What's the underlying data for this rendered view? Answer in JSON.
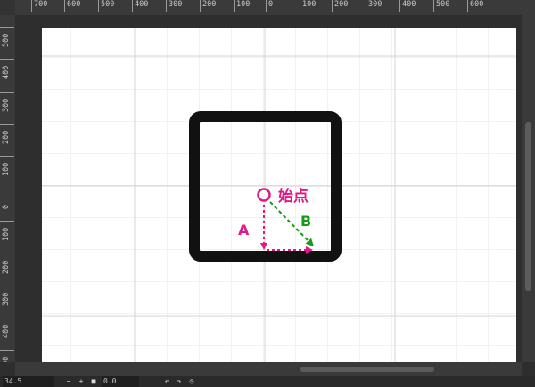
{
  "ruler_top": [
    "700",
    "600",
    "500",
    "400",
    "300",
    "200",
    "100",
    "0",
    "100",
    "200",
    "300",
    "400",
    "500",
    "600"
  ],
  "ruler_left": [
    "500",
    "400",
    "300",
    "200",
    "100",
    "0",
    "100",
    "200",
    "300",
    "400",
    "500"
  ],
  "annotation": {
    "start_label": "始点",
    "label_a": "A",
    "label_b": "B"
  },
  "statusbar": {
    "zoom": "34.5",
    "zoom_out": "−",
    "zoom_in": "+",
    "reset": "■",
    "angle": "0.0",
    "rotate_left": "↶",
    "rotate_right": "↷",
    "rotate_reset": "◷"
  },
  "colors": {
    "workspace": "#2e2e2e",
    "ruler": "#3a3a3a",
    "canvas": "#ffffff",
    "grid": "#e0e0e0",
    "frame": "#111111",
    "magenta": "#e0188a",
    "green": "#1a9a1a"
  }
}
